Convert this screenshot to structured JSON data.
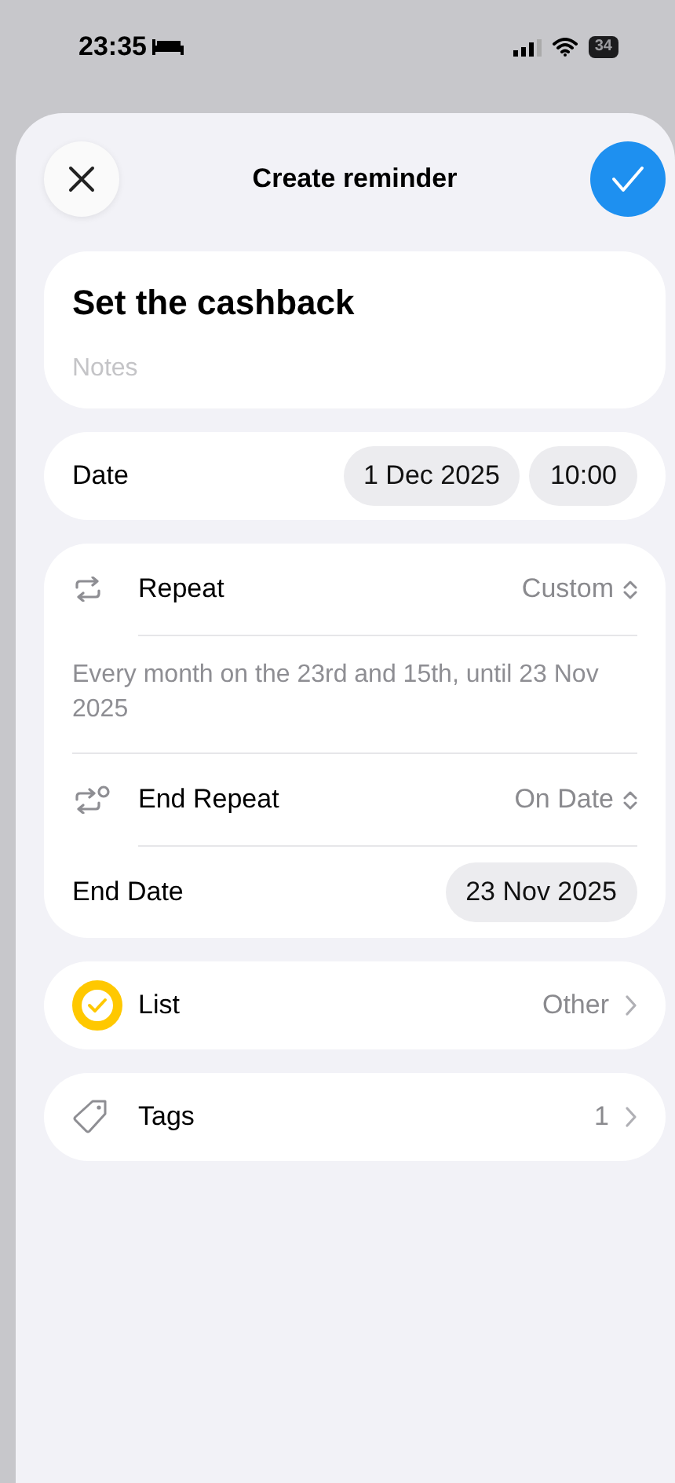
{
  "status_bar": {
    "time": "23:35",
    "battery": "34"
  },
  "header": {
    "title": "Create reminder"
  },
  "reminder": {
    "title": "Set the cashback",
    "notes_placeholder": "Notes"
  },
  "date": {
    "label": "Date",
    "date": "1 Dec 2025",
    "time": "10:00"
  },
  "repeat": {
    "label": "Repeat",
    "value": "Custom",
    "summary": "Every month on the 23rd and 15th, until 23 Nov 2025",
    "end_label": "End Repeat",
    "end_value": "On Date",
    "end_date_label": "End Date",
    "end_date": "23 Nov 2025"
  },
  "list": {
    "label": "List",
    "value": "Other"
  },
  "tags": {
    "label": "Tags",
    "count": "1"
  }
}
